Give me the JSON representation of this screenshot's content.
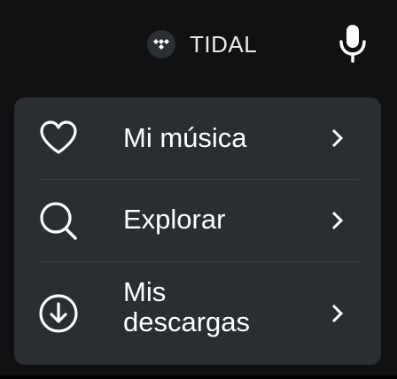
{
  "header": {
    "app_name": "TIDAL",
    "logo_icon": "tidal-logo-icon",
    "mic_icon": "microphone-icon"
  },
  "menu": {
    "items": [
      {
        "label": "Mi música",
        "icon": "heart-icon",
        "chevron": "chevron-right-icon"
      },
      {
        "label": "Explorar",
        "icon": "search-icon",
        "chevron": "chevron-right-icon"
      },
      {
        "label": "Mis descargas",
        "icon": "download-circle-icon",
        "chevron": "chevron-right-icon"
      }
    ]
  },
  "colors": {
    "background": "#0f1112",
    "card": "#2a2d31",
    "text": "#ffffff",
    "divider": "#3d4146"
  }
}
